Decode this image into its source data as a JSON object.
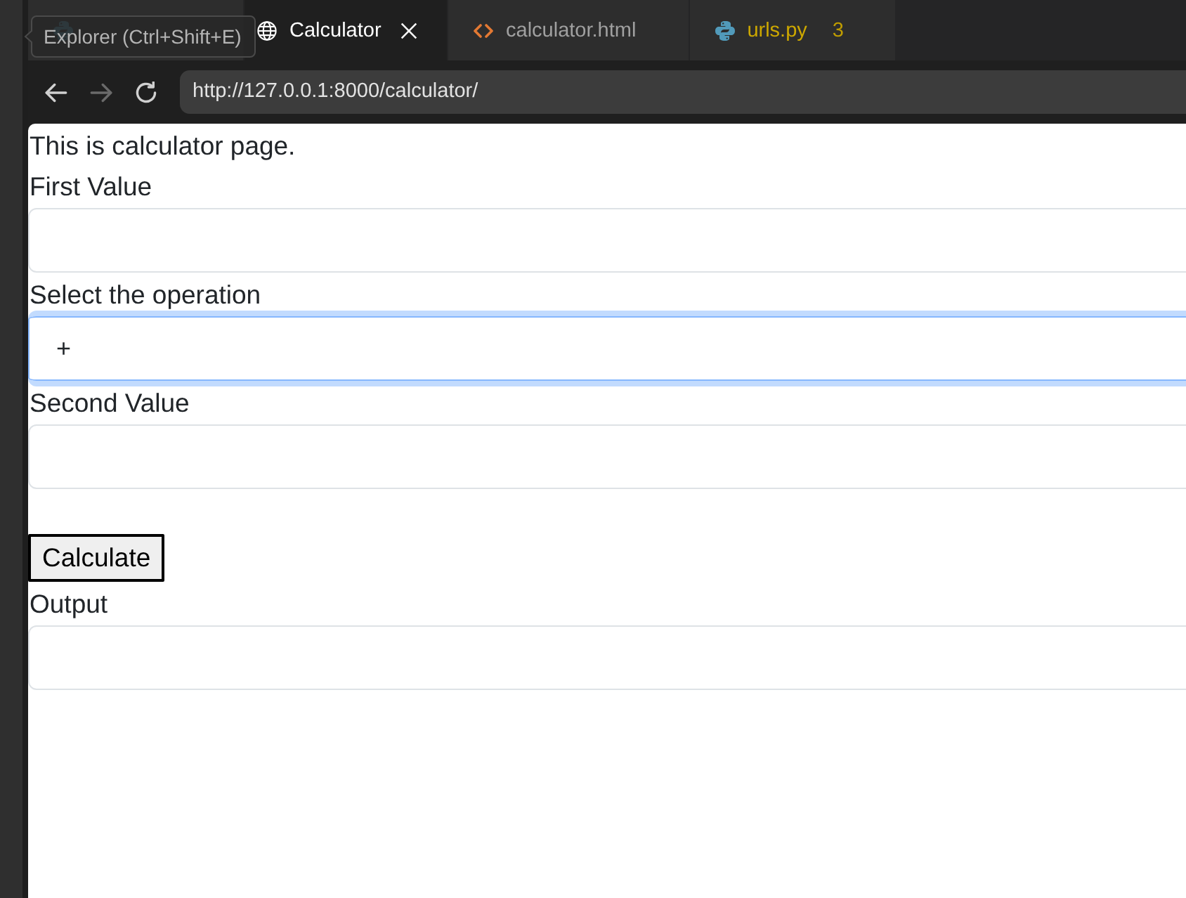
{
  "tooltip": {
    "text": "Explorer (Ctrl+Shift+E)"
  },
  "editor_tabs": [
    {
      "kind": "python",
      "selected": false
    },
    {
      "kind": "browser",
      "label": "Calculator",
      "selected": true
    },
    {
      "kind": "html",
      "label": "calculator.html",
      "selected": false
    },
    {
      "kind": "python",
      "label": "urls.py",
      "badge": "3",
      "selected": false
    }
  ],
  "browser": {
    "nav_buttons": [
      {
        "kind": "back",
        "disabled": false
      },
      {
        "kind": "forward",
        "disabled": true
      },
      {
        "kind": "reload",
        "disabled": false
      }
    ],
    "url": "http://127.0.0.1:8000/calculator/"
  },
  "page": {
    "intro": "This is calculator page.",
    "form": [
      {
        "kind": "input",
        "label": "First Value",
        "focused": false
      },
      {
        "kind": "select",
        "label": "Select the operation",
        "value": "+",
        "focused": true
      },
      {
        "kind": "input",
        "label": "Second Value",
        "focused": false
      },
      {
        "kind": "button",
        "label": "Calculate"
      },
      {
        "kind": "output",
        "label": "Output",
        "focused": false
      }
    ]
  }
}
